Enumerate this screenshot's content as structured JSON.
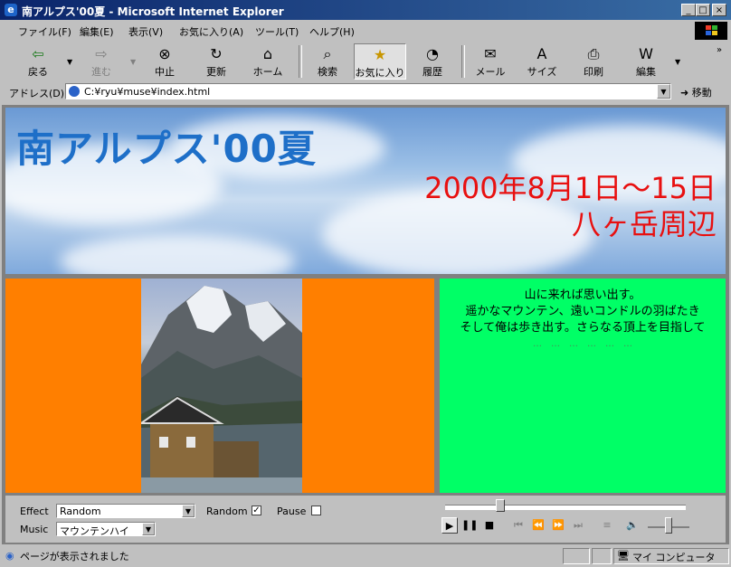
{
  "window": {
    "title": "南アルプス'00夏 - Microsoft Internet Explorer",
    "controls": {
      "minimize": "_",
      "maximize": "□",
      "close": "×"
    }
  },
  "menu": [
    {
      "label": "ファイル(F)"
    },
    {
      "label": "編集(E)"
    },
    {
      "label": "表示(V)"
    },
    {
      "label": "お気に入り(A)"
    },
    {
      "label": "ツール(T)"
    },
    {
      "label": "ヘルプ(H)"
    }
  ],
  "toolbar": {
    "back": {
      "label": "戻る",
      "icon": "back-arrow-icon"
    },
    "forward": {
      "label": "進む",
      "icon": "forward-arrow-icon"
    },
    "stop": {
      "label": "中止",
      "icon": "stop-icon"
    },
    "refresh": {
      "label": "更新",
      "icon": "refresh-icon"
    },
    "home": {
      "label": "ホーム",
      "icon": "home-icon"
    },
    "search": {
      "label": "検索",
      "icon": "search-icon"
    },
    "favorites": {
      "label": "お気に入り",
      "icon": "favorites-icon"
    },
    "history": {
      "label": "履歴",
      "icon": "history-icon"
    },
    "mail": {
      "label": "メール",
      "icon": "mail-icon"
    },
    "size": {
      "label": "サイズ",
      "icon": "font-size-icon"
    },
    "print": {
      "label": "印刷",
      "icon": "print-icon"
    },
    "edit": {
      "label": "編集",
      "icon": "edit-icon"
    }
  },
  "address": {
    "label": "アドレス(D)",
    "value": "C:¥ryu¥muse¥index.html",
    "go_label": "移動"
  },
  "page": {
    "title": "南アルプス'00夏",
    "date": "2000年8月1日～15日",
    "place": "八ヶ岳周辺",
    "poem": [
      "山に来れば思い出す。",
      "遥かなマウンテン、遠いコンドルの羽ばたき",
      "そして俺は歩き出す。さらなる頂上を目指して",
      "…　…　…　…　…　…"
    ],
    "colors": {
      "left_bg": "#ff7f00",
      "right_bg": "#00ff66",
      "title": "#1e6fc8",
      "date": "#e81010"
    }
  },
  "player": {
    "effect_label": "Effect",
    "effect_value": "Random",
    "random_label": "Random",
    "random_checked": true,
    "pause_label": "Pause",
    "pause_checked": false,
    "music_label": "Music",
    "music_value": "マウンテンハイ",
    "seek_position": 0.23,
    "volume": 0.5
  },
  "status": {
    "text": "ページが表示されました",
    "zone": "マイ コンピュータ"
  }
}
